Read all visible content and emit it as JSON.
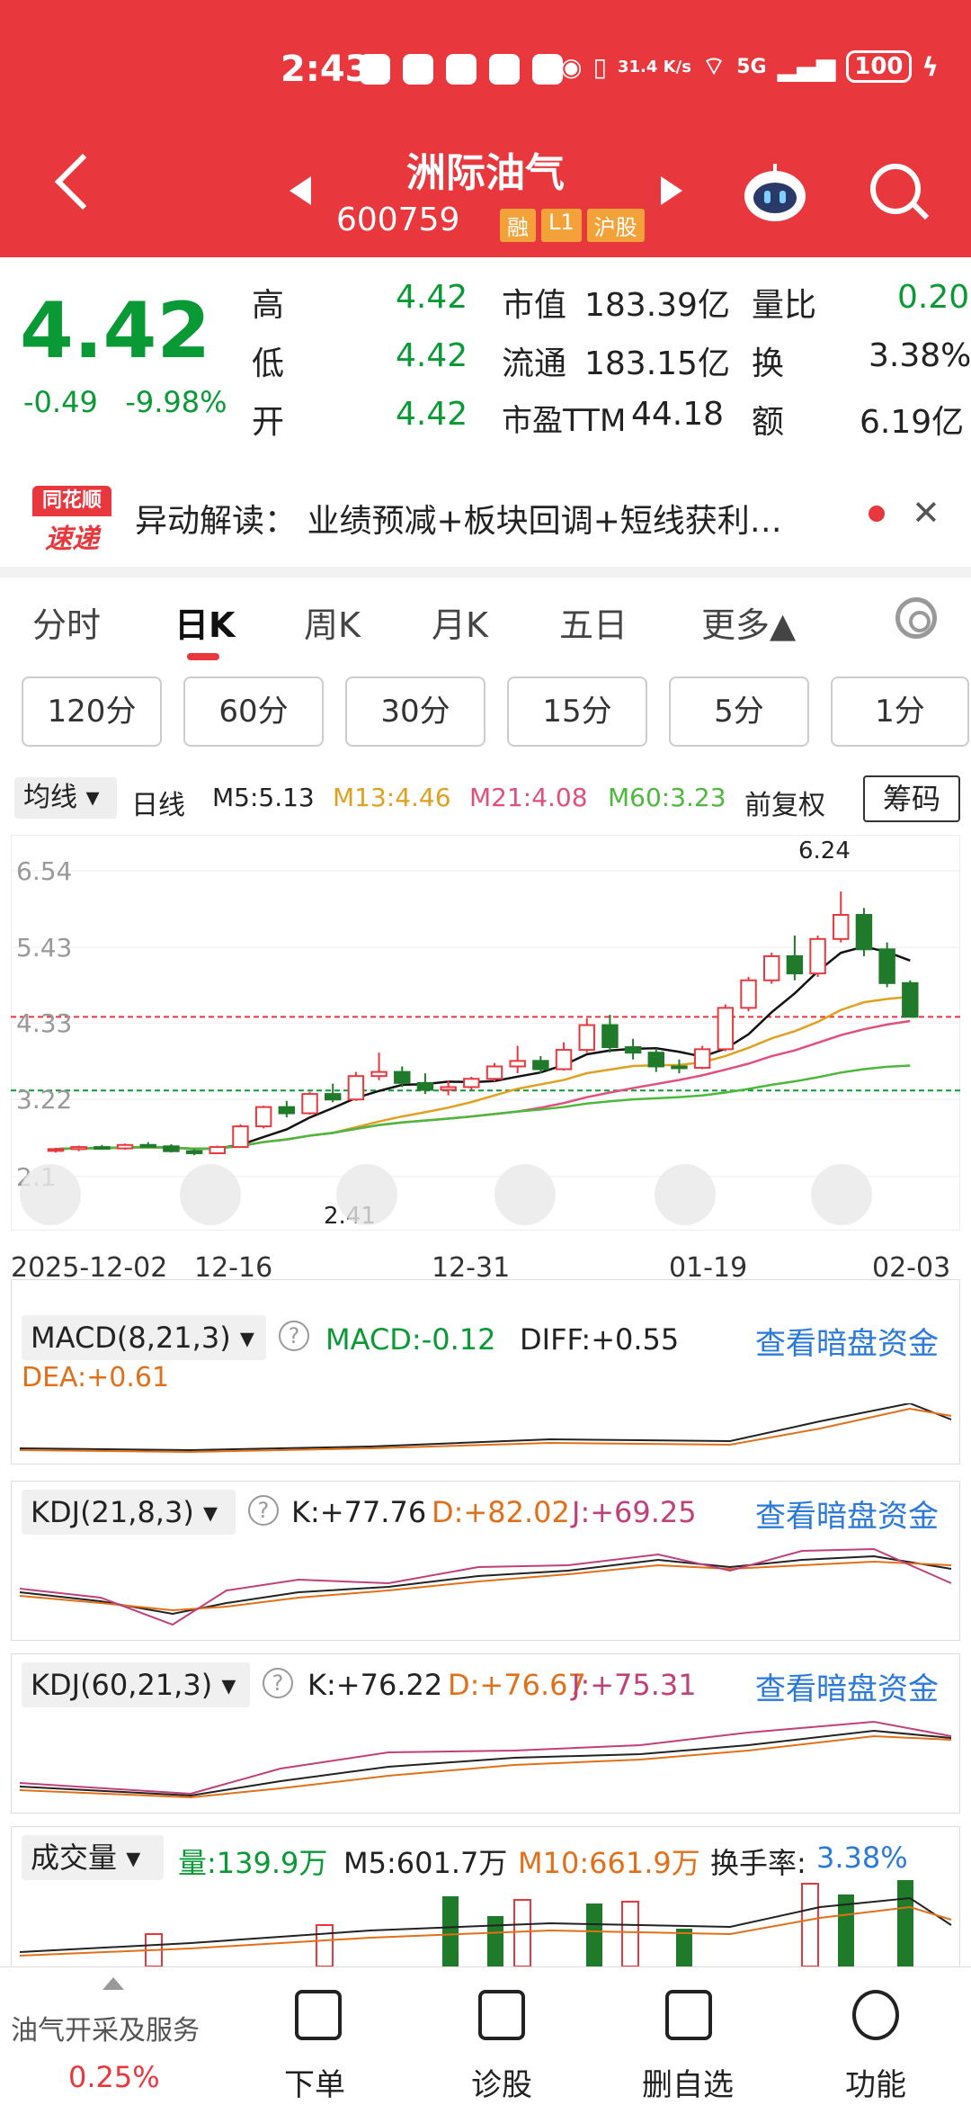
{
  "status_bar": {
    "time": "2:43",
    "net_speed": "31.4 K/s",
    "network": "5G",
    "battery": "100"
  },
  "header": {
    "stock_name": "洲际油气",
    "stock_code": "600759",
    "badges": [
      "融",
      "L1",
      "沪股"
    ]
  },
  "quote": {
    "price": "4.42",
    "change": "-0.49",
    "change_pct": "-9.98%",
    "rows": [
      {
        "k1": "高",
        "v1": "4.42",
        "k2": "市值",
        "v2": "183.39亿",
        "k3": "量比",
        "v3": "0.20"
      },
      {
        "k1": "低",
        "v1": "4.42",
        "k2": "流通",
        "v2": "183.15亿",
        "k3": "换",
        "v3": "3.38%"
      },
      {
        "k1": "开",
        "v1": "4.42",
        "k2": "市盈TTM",
        "v2": "44.18",
        "k3": "额",
        "v3": "6.19亿"
      }
    ]
  },
  "news": {
    "logo_top": "同花顺",
    "logo_bottom": "速递",
    "text": "异动解读：  业绩预减+板块回调+短线获利…"
  },
  "tabs": [
    "分时",
    "日K",
    "周K",
    "月K",
    "五日",
    "更多▲"
  ],
  "periods": [
    "120分",
    "60分",
    "30分",
    "15分",
    "5分",
    "1分"
  ],
  "indicator": {
    "chip": "均线",
    "line": "日线",
    "m5": "M5:5.13",
    "m13": "M13:4.46",
    "m21": "M21:4.08",
    "m60": "M60:3.23",
    "adjust": "前复权",
    "chips_btn": "筹码"
  },
  "chart_data": {
    "type": "candlestick",
    "y_ticks": [
      "6.54",
      "5.43",
      "4.33",
      "3.22",
      "2.1"
    ],
    "x_ticks": [
      "2025-12-02",
      "12-16",
      "12-31",
      "01-19",
      "02-03"
    ],
    "annotations": {
      "high": "6.24",
      "low": "2.41"
    },
    "candles": [
      [
        2.48,
        2.52,
        2.45,
        2.5
      ],
      [
        2.5,
        2.55,
        2.47,
        2.53
      ],
      [
        2.53,
        2.56,
        2.49,
        2.51
      ],
      [
        2.51,
        2.58,
        2.49,
        2.56
      ],
      [
        2.56,
        2.6,
        2.52,
        2.54
      ],
      [
        2.54,
        2.57,
        2.45,
        2.47
      ],
      [
        2.47,
        2.5,
        2.41,
        2.44
      ],
      [
        2.44,
        2.55,
        2.43,
        2.53
      ],
      [
        2.53,
        2.86,
        2.52,
        2.83
      ],
      [
        2.83,
        3.13,
        2.8,
        3.11
      ],
      [
        3.11,
        3.2,
        2.96,
        3.02
      ],
      [
        3.02,
        3.33,
        3.0,
        3.3
      ],
      [
        3.3,
        3.45,
        3.18,
        3.22
      ],
      [
        3.22,
        3.62,
        3.2,
        3.56
      ],
      [
        3.56,
        3.9,
        3.5,
        3.62
      ],
      [
        3.62,
        3.7,
        3.4,
        3.46
      ],
      [
        3.46,
        3.6,
        3.3,
        3.36
      ],
      [
        3.36,
        3.5,
        3.28,
        3.4
      ],
      [
        3.4,
        3.55,
        3.36,
        3.52
      ],
      [
        3.52,
        3.75,
        3.48,
        3.7
      ],
      [
        3.7,
        4.0,
        3.6,
        3.78
      ],
      [
        3.78,
        3.85,
        3.6,
        3.66
      ],
      [
        3.66,
        4.05,
        3.64,
        3.94
      ],
      [
        3.94,
        4.4,
        3.9,
        4.3
      ],
      [
        4.3,
        4.45,
        3.9,
        3.98
      ],
      [
        3.98,
        4.1,
        3.8,
        3.9
      ],
      [
        3.9,
        3.96,
        3.62,
        3.7
      ],
      [
        3.7,
        3.8,
        3.6,
        3.68
      ],
      [
        3.68,
        4.0,
        3.66,
        3.95
      ],
      [
        3.95,
        4.6,
        3.92,
        4.55
      ],
      [
        4.55,
        5.0,
        4.5,
        4.95
      ],
      [
        4.95,
        5.35,
        4.9,
        5.3
      ],
      [
        5.3,
        5.6,
        4.95,
        5.05
      ],
      [
        5.05,
        5.6,
        5.0,
        5.55
      ],
      [
        5.55,
        6.24,
        5.5,
        5.9
      ],
      [
        5.9,
        6.0,
        5.3,
        5.4
      ],
      [
        5.4,
        5.5,
        4.85,
        4.91
      ],
      [
        4.91,
        4.95,
        4.42,
        4.42
      ]
    ],
    "ma_lines": [
      {
        "name": "M5",
        "color": "#111111"
      },
      {
        "name": "M13",
        "color": "#e0a020"
      },
      {
        "name": "M21",
        "color": "#e0507a"
      },
      {
        "name": "M60",
        "color": "#4cb83c"
      }
    ]
  },
  "macd": {
    "chip": "MACD(8,21,3)",
    "macd": "MACD:-0.12",
    "diff": "DIFF:+0.55",
    "dea": "DEA:+0.61",
    "link": "查看暗盘资金"
  },
  "kdj1": {
    "chip": "KDJ(21,8,3)",
    "k": "K:+77.76",
    "d": "D:+82.02",
    "j": "J:+69.25",
    "link": "查看暗盘资金"
  },
  "kdj2": {
    "chip": "KDJ(60,21,3)",
    "k": "K:+76.22",
    "d": "D:+76.67",
    "j": "J:+75.31",
    "link": "查看暗盘资金"
  },
  "volume": {
    "chip": "成交量",
    "vol": "量:139.9万",
    "m5": "M5:601.7万",
    "m10": "M10:661.9万",
    "turnover_label": "换手率:",
    "turnover": "3.38%"
  },
  "bottom_nav": {
    "sector": "油气开采及服务",
    "sector_pct": "0.25%",
    "items": [
      "下单",
      "诊股",
      "删自选",
      "功能"
    ]
  },
  "colors": {
    "brand_red": "#e8383d",
    "down_green": "#0a9a35",
    "link_blue": "#2b79d8"
  }
}
